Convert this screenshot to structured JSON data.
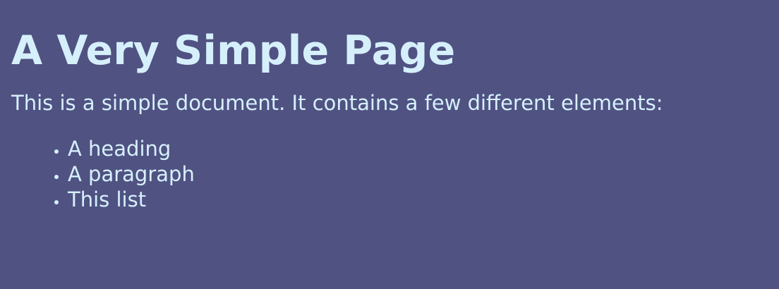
{
  "document": {
    "heading": "A Very Simple Page",
    "paragraph": "This is a simple document. It contains a few different elements:",
    "list_items": [
      "A heading",
      "A paragraph",
      "This list"
    ]
  },
  "colors": {
    "background": "#505282",
    "text": "#d6f0fb"
  }
}
